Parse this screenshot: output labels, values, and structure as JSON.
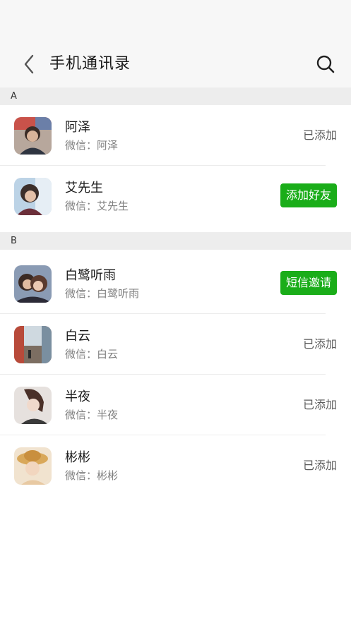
{
  "header": {
    "title": "手机通讯录",
    "back_icon": "chevron-left-icon",
    "search_icon": "search-icon"
  },
  "wechat_prefix": "微信：",
  "sections": [
    {
      "letter": "A",
      "contacts": [
        {
          "name": "阿泽",
          "wechat": "微信：阿泽",
          "status": "已添加",
          "action": null
        },
        {
          "name": "艾先生",
          "wechat": "微信：艾先生",
          "status": null,
          "action": "添加好友"
        }
      ]
    },
    {
      "letter": "B",
      "contacts": [
        {
          "name": "白鹭听雨",
          "wechat": "微信：白鹭听雨",
          "status": null,
          "action": "短信邀请"
        },
        {
          "name": "白云",
          "wechat": "微信：白云",
          "status": "已添加",
          "action": null
        },
        {
          "name": "半夜",
          "wechat": "微信：半夜",
          "status": "已添加",
          "action": null
        },
        {
          "name": "彬彬",
          "wechat": "微信：彬彬",
          "status": "已添加",
          "action": null
        }
      ]
    }
  ],
  "colors": {
    "accent_green": "#1aad19",
    "section_bg": "#ededed",
    "topbar_bg": "#f7f7f7"
  }
}
